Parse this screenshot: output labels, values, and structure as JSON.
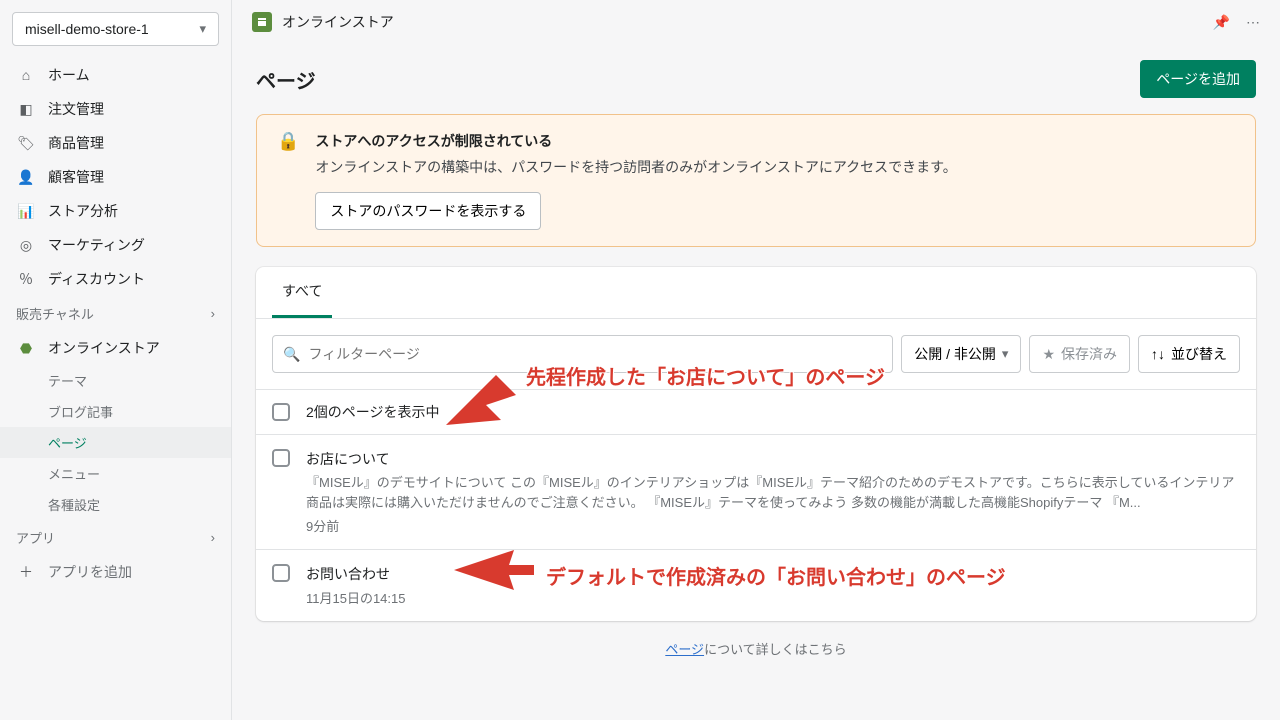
{
  "store": {
    "name": "misell-demo-store-1"
  },
  "nav": {
    "home": "ホーム",
    "orders": "注文管理",
    "products": "商品管理",
    "customers": "顧客管理",
    "analytics": "ストア分析",
    "marketing": "マーケティング",
    "discounts": "ディスカウント",
    "sales_channels": "販売チャネル",
    "online_store": "オンラインストア",
    "themes": "テーマ",
    "blog_posts": "ブログ記事",
    "pages": "ページ",
    "navigation": "メニュー",
    "preferences": "各種設定",
    "apps": "アプリ",
    "add_app": "アプリを追加"
  },
  "topbar": {
    "title": "オンラインストア"
  },
  "page": {
    "title": "ページ",
    "add_button": "ページを追加"
  },
  "alert": {
    "title": "ストアへのアクセスが制限されている",
    "body": "オンラインストアの構築中は、パスワードを持つ訪問者のみがオンラインストアにアクセスできます。",
    "button": "ストアのパスワードを表示する"
  },
  "tabs": {
    "all": "すべて"
  },
  "toolbar": {
    "search_placeholder": "フィルターページ",
    "visibility": "公開 / 非公開",
    "saved": "保存済み",
    "sort": "並び替え"
  },
  "list": {
    "header": "2個のページを表示中",
    "items": [
      {
        "title": "お店について",
        "desc": "『MISEル』のデモサイトについて この『MISEル』のインテリアショップは『MISEル』テーマ紹介のためのデモストアです。こちらに表示しているインテリア商品は実際には購入いただけませんのでご注意ください。 『MISEル』テーマを使ってみよう 多数の機能が満載した高機能Shopifyテーマ 『M...",
        "time": "9分前"
      },
      {
        "title": "お問い合わせ",
        "desc": "",
        "time": "11月15日の14:15"
      }
    ]
  },
  "footer": {
    "link_text": "ページ",
    "suffix": "について詳しくはこちら"
  },
  "annotations": {
    "a1": "先程作成した「お店について」のページ",
    "a2": "デフォルトで作成済みの「お問い合わせ」のページ"
  }
}
